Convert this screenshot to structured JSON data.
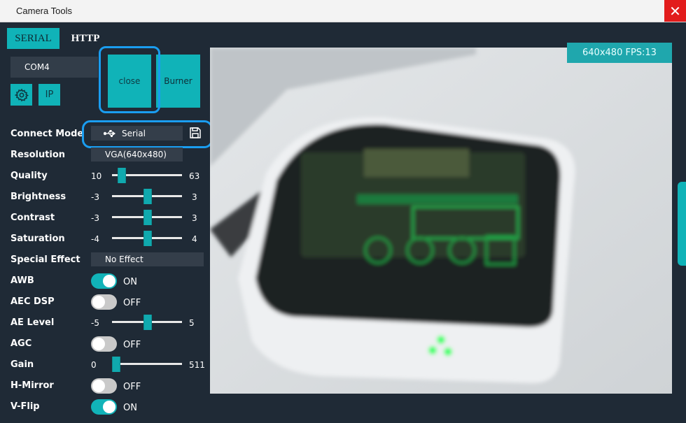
{
  "window": {
    "title": "Camera Tools",
    "close_glyph": "✕"
  },
  "tabs": [
    {
      "label": "SERIAL",
      "active": true
    },
    {
      "label": "HTTP",
      "active": false
    }
  ],
  "connection": {
    "port": "COM4",
    "close_label": "close",
    "burner_label": "Burner",
    "settings_icon": "gear-icon",
    "ip_label": "IP"
  },
  "controls": {
    "connect_mode": {
      "label": "Connect Mode",
      "value": "Serial",
      "icon": "usb-icon",
      "save_icon": "save-icon"
    },
    "resolution": {
      "label": "Resolution",
      "value": "VGA(640x480)"
    },
    "quality": {
      "label": "Quality",
      "min": "10",
      "max": "63",
      "value": 10
    },
    "brightness": {
      "label": "Brightness",
      "min": "-3",
      "max": "3",
      "value": 0
    },
    "contrast": {
      "label": "Contrast",
      "min": "-3",
      "max": "3",
      "value": 0
    },
    "saturation": {
      "label": "Saturation",
      "min": "-4",
      "max": "4",
      "value": 0
    },
    "special_effect": {
      "label": "Special Effect",
      "value": "No Effect"
    },
    "awb": {
      "label": "AWB",
      "state": "ON"
    },
    "aec_dsp": {
      "label": "AEC DSP",
      "state": "OFF"
    },
    "ae_level": {
      "label": "AE Level",
      "min": "-5",
      "max": "5",
      "value": 0
    },
    "agc": {
      "label": "AGC",
      "state": "OFF"
    },
    "gain": {
      "label": "Gain",
      "min": "0",
      "max": "511",
      "value": 0
    },
    "h_mirror": {
      "label": "H-Mirror",
      "state": "OFF"
    },
    "v_flip": {
      "label": "V-Flip",
      "state": "ON"
    }
  },
  "preview": {
    "fps_overlay": "640x480 FPS:13"
  },
  "colors": {
    "accent": "#10b3b8",
    "highlight_ring": "#1a9df0",
    "close": "#e21c1c",
    "panel": "#1f2a36"
  }
}
